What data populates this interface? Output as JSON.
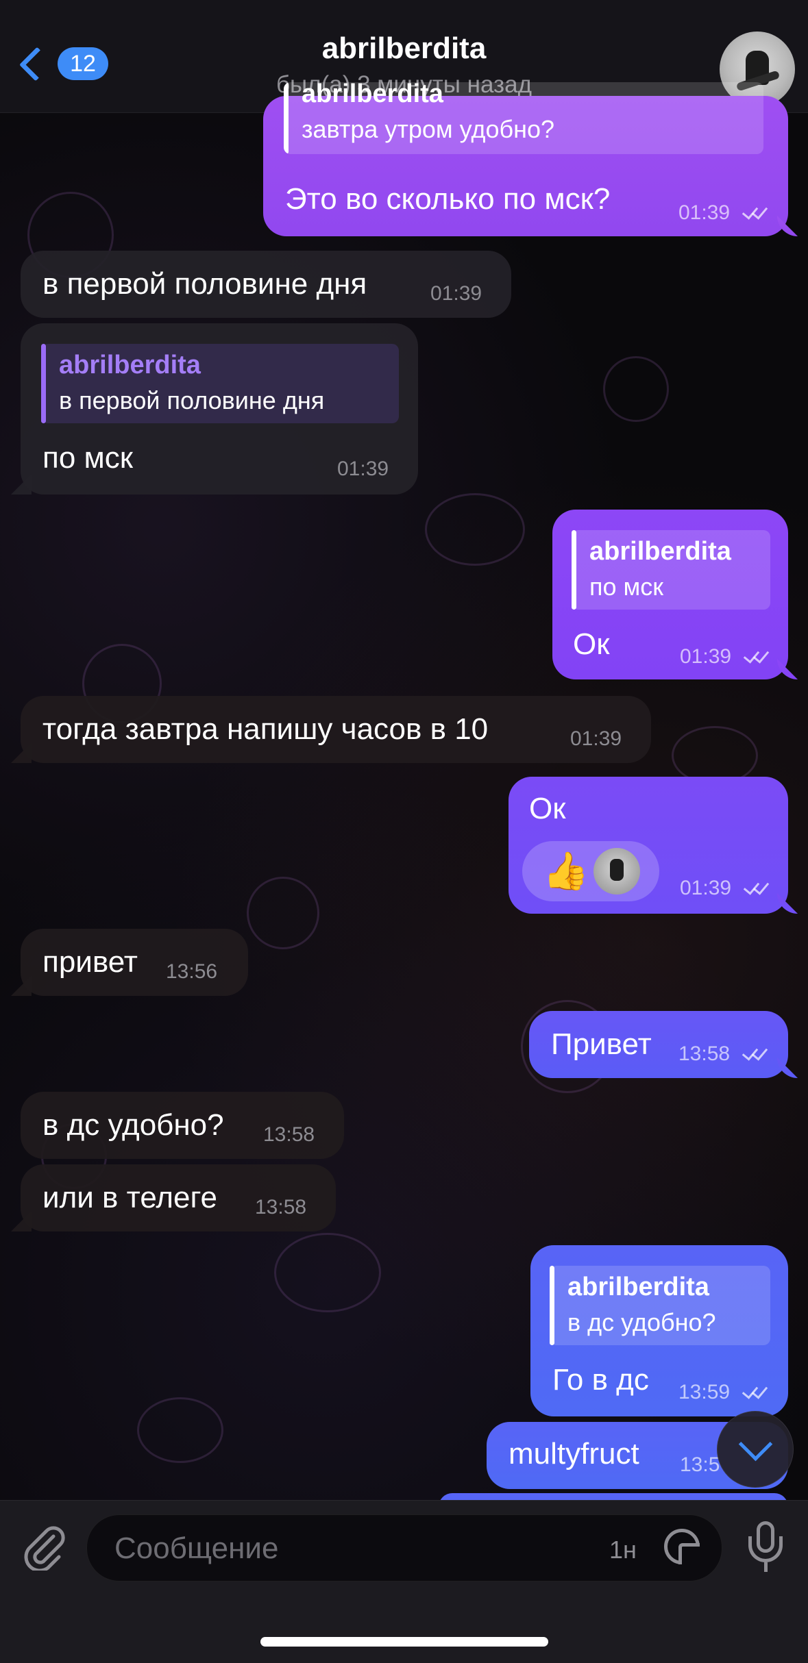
{
  "header": {
    "back_count": "12",
    "title": "abrilberdita",
    "status": "был(а) 3 минуты назад"
  },
  "messages": [
    {
      "dir": "out",
      "quote_text": "завтра утром удобно?",
      "quote_name_partial": "abrilberdita",
      "text": "Это во сколько по мск?",
      "time": "01:39"
    },
    {
      "dir": "in",
      "text": "в первой половине дня",
      "time": "01:39"
    },
    {
      "dir": "in",
      "quote_name": "abrilberdita",
      "quote_text": "в первой половине дня",
      "text": "по мск",
      "time": "01:39"
    },
    {
      "dir": "out",
      "quote_name": "abrilberdita",
      "quote_text": "по мск",
      "text": "Ок",
      "time": "01:39"
    },
    {
      "dir": "in",
      "text": "тогда завтра напишу часов в 10",
      "time": "01:39"
    },
    {
      "dir": "out",
      "text": "Ок",
      "time": "01:39",
      "reaction": "👍"
    },
    {
      "dir": "in",
      "text": "привет",
      "time": "13:56"
    },
    {
      "dir": "out",
      "text": "Привет",
      "time": "13:58"
    },
    {
      "dir": "in",
      "text": "в дс удобно?",
      "time": "13:58"
    },
    {
      "dir": "in",
      "text": "или в телеге",
      "time": "13:58"
    },
    {
      "dir": "out",
      "quote_name": "abrilberdita",
      "quote_text": "в дс удобно?",
      "text": "Го в дс",
      "time": "13:59"
    },
    {
      "dir": "out",
      "text": "multyfruct",
      "time": "13:5"
    }
  ],
  "composer": {
    "placeholder": "Сообщение",
    "timer": "1н"
  },
  "icons": {
    "back": "chevron-left-icon",
    "attach": "paperclip-icon",
    "sticker": "sticker-icon",
    "mic": "microphone-icon",
    "scroll": "chevron-down-icon"
  },
  "colors": {
    "accent": "#3e8cf7",
    "outgoing_top": "#9f4ff2",
    "outgoing_bottom": "#4f6af5",
    "incoming": "#242228"
  }
}
